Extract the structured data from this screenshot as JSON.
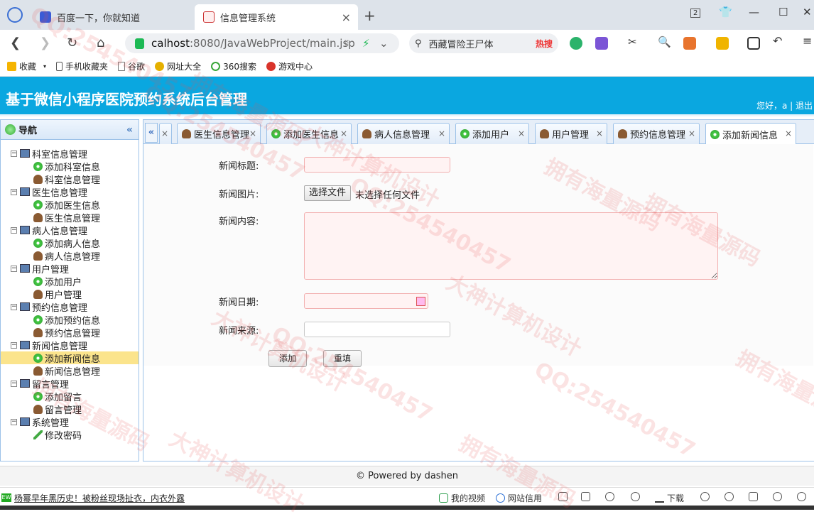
{
  "browser": {
    "tabs": [
      {
        "title": "百度一下，你就知道",
        "active": false
      },
      {
        "title": "信息管理系统",
        "active": true
      }
    ],
    "url_host": "calhost",
    "url_path": ":8080/JavaWebProject/main.jsp",
    "search_text": "西藏冒险王尸体",
    "search_badge": "热搜",
    "tab_count": "2",
    "bookmarks": [
      "收藏",
      "手机收藏夹",
      "谷歌",
      "网址大全",
      "360搜索",
      "游戏中心"
    ]
  },
  "app": {
    "title": "基于微信小程序医院预约系统后台管理",
    "greeting": "您好，a | 退出"
  },
  "sidebar": {
    "header": "导航",
    "groups": [
      {
        "label": "科室信息管理",
        "items": [
          {
            "label": "添加科室信息",
            "icon": "add"
          },
          {
            "label": "科室信息管理",
            "icon": "user"
          }
        ]
      },
      {
        "label": "医生信息管理",
        "items": [
          {
            "label": "添加医生信息",
            "icon": "add"
          },
          {
            "label": "医生信息管理",
            "icon": "user"
          }
        ]
      },
      {
        "label": "病人信息管理",
        "items": [
          {
            "label": "添加病人信息",
            "icon": "add"
          },
          {
            "label": "病人信息管理",
            "icon": "user"
          }
        ]
      },
      {
        "label": "用户管理",
        "items": [
          {
            "label": "添加用户",
            "icon": "add"
          },
          {
            "label": "用户管理",
            "icon": "user"
          }
        ]
      },
      {
        "label": "预约信息管理",
        "items": [
          {
            "label": "添加预约信息",
            "icon": "add"
          },
          {
            "label": "预约信息管理",
            "icon": "user"
          }
        ]
      },
      {
        "label": "新闻信息管理",
        "items": [
          {
            "label": "添加新闻信息",
            "icon": "add",
            "selected": true
          },
          {
            "label": "新闻信息管理",
            "icon": "user"
          }
        ]
      },
      {
        "label": "留言管理",
        "items": [
          {
            "label": "添加留言",
            "icon": "add"
          },
          {
            "label": "留言管理",
            "icon": "user"
          }
        ]
      },
      {
        "label": "系统管理",
        "items": [
          {
            "label": "修改密码",
            "icon": "pen"
          }
        ]
      }
    ]
  },
  "content_tabs": [
    {
      "label": "医生信息管理",
      "icon": "user"
    },
    {
      "label": "添加医生信息",
      "icon": "add"
    },
    {
      "label": "病人信息管理",
      "icon": "user"
    },
    {
      "label": "添加用户",
      "icon": "add"
    },
    {
      "label": "用户管理",
      "icon": "user"
    },
    {
      "label": "预约信息管理",
      "icon": "user"
    },
    {
      "label": "添加新闻信息",
      "icon": "add",
      "active": true
    }
  ],
  "form": {
    "title_label": "新闻标题:",
    "title_value": "",
    "image_label": "新闻图片:",
    "file_button": "选择文件",
    "file_status": "未选择任何文件",
    "content_label": "新闻内容:",
    "content_value": "",
    "date_label": "新闻日期:",
    "date_value": "",
    "source_label": "新闻来源:",
    "source_value": "",
    "submit": "添加",
    "reset": "重填"
  },
  "footer": "© Powered by dashen",
  "statusbar": {
    "news": "杨幂早年黑历史！被粉丝现场扯衣，内衣外露",
    "news_badge": "EW",
    "video": "我的视频",
    "speed": "网站信用",
    "download": "下载"
  },
  "watermark": [
    "QQ:254540457",
    "拥有海量源码",
    "大神计算机设计"
  ]
}
